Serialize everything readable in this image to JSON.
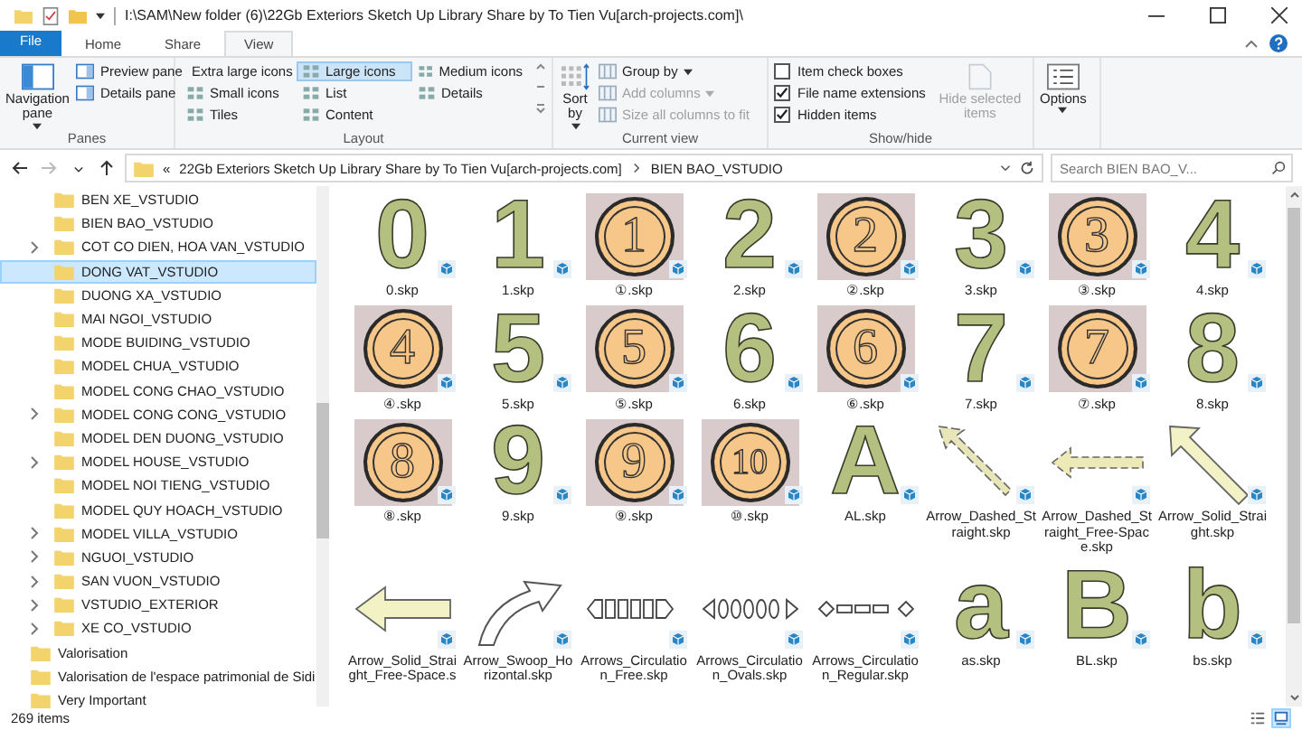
{
  "window": {
    "title": "I:\\SAM\\New folder (6)\\22Gb Exteriors Sketch Up Library Share by To Tien Vu[arch-projects.com]\\"
  },
  "ribbon_tabs": [
    {
      "label": "File",
      "kind": "file",
      "selected": false
    },
    {
      "label": "Home",
      "kind": "tab",
      "selected": false
    },
    {
      "label": "Share",
      "kind": "tab",
      "selected": false
    },
    {
      "label": "View",
      "kind": "tab",
      "selected": true
    }
  ],
  "ribbon": {
    "panes": {
      "title": "Panes",
      "navigation_pane": "Navigation pane",
      "preview_pane": "Preview pane",
      "details_pane": "Details pane"
    },
    "layout": {
      "title": "Layout",
      "options": [
        {
          "label": "Extra large icons",
          "selected": false
        },
        {
          "label": "Large icons",
          "selected": true
        },
        {
          "label": "Medium icons",
          "selected": false
        },
        {
          "label": "Small icons",
          "selected": false
        },
        {
          "label": "List",
          "selected": false
        },
        {
          "label": "Details",
          "selected": false
        },
        {
          "label": "Tiles",
          "selected": false
        },
        {
          "label": "Content",
          "selected": false
        }
      ]
    },
    "current_view": {
      "title": "Current view",
      "sort_by": "Sort by",
      "items": [
        {
          "label": "Group by",
          "disabled": false
        },
        {
          "label": "Add columns",
          "disabled": true
        },
        {
          "label": "Size all columns to fit",
          "disabled": true
        }
      ]
    },
    "show_hide": {
      "title": "Show/hide",
      "checkboxes": [
        {
          "label": "Item check boxes",
          "checked": false
        },
        {
          "label": "File name extensions",
          "checked": true
        },
        {
          "label": "Hidden items",
          "checked": true
        }
      ],
      "hide_selected": {
        "label": "Hide selected items",
        "disabled": true
      }
    },
    "options": "Options"
  },
  "address_bar": {
    "nav_buttons": [
      {
        "kind": "back",
        "disabled": false
      },
      {
        "kind": "forward",
        "disabled": true
      },
      {
        "kind": "recent",
        "disabled": false
      },
      {
        "kind": "up",
        "disabled": false
      }
    ],
    "overflow": "«",
    "path": [
      "22Gb Exteriors Sketch Up Library Share by To Tien Vu[arch-projects.com]",
      "BIEN BAO_VSTUDIO"
    ],
    "search": {
      "placeholder": "Search BIEN BAO_V..."
    }
  },
  "sidebar": {
    "subfolders": [
      {
        "label": "BEN XE_VSTUDIO",
        "expandable": false,
        "selected": false
      },
      {
        "label": "BIEN BAO_VSTUDIO",
        "expandable": false,
        "selected": false
      },
      {
        "label": "COT CO DIEN, HOA VAN_VSTUDIO",
        "expandable": true,
        "selected": false
      },
      {
        "label": "DONG VAT_VSTUDIO",
        "expandable": false,
        "selected": true
      },
      {
        "label": "DUONG XA_VSTUDIO",
        "expandable": false,
        "selected": false
      },
      {
        "label": "MAI NGOI_VSTUDIO",
        "expandable": false,
        "selected": false
      },
      {
        "label": "MODE BUIDING_VSTUDIO",
        "expandable": false,
        "selected": false
      },
      {
        "label": "MODEL CHUA_VSTUDIO",
        "expandable": false,
        "selected": false
      },
      {
        "label": "MODEL CONG CHAO_VSTUDIO",
        "expandable": false,
        "selected": false
      },
      {
        "label": "MODEL CONG CONG_VSTUDIO",
        "expandable": true,
        "selected": false
      },
      {
        "label": "MODEL DEN DUONG_VSTUDIO",
        "expandable": false,
        "selected": false
      },
      {
        "label": "MODEL HOUSE_VSTUDIO",
        "expandable": true,
        "selected": false
      },
      {
        "label": "MODEL NOI TIENG_VSTUDIO",
        "expandable": false,
        "selected": false
      },
      {
        "label": "MODEL QUY HOACH_VSTUDIO",
        "expandable": false,
        "selected": false
      },
      {
        "label": "MODEL VILLA_VSTUDIO",
        "expandable": true,
        "selected": false
      },
      {
        "label": "NGUOI_VSTUDIO",
        "expandable": true,
        "selected": false
      },
      {
        "label": "SAN VUON_VSTUDIO",
        "expandable": true,
        "selected": false
      },
      {
        "label": "VSTUDIO_EXTERIOR",
        "expandable": true,
        "selected": false
      },
      {
        "label": "XE CO_VSTUDIO",
        "expandable": true,
        "selected": false
      }
    ],
    "folders": [
      {
        "label": "Valorisation",
        "expandable": false,
        "selected": false
      },
      {
        "label": "Valorisation de  l'espace patrimonial de Sidi",
        "expandable": false,
        "selected": false
      },
      {
        "label": "Very Important",
        "expandable": false,
        "selected": false
      }
    ]
  },
  "files": [
    {
      "name": "0.skp",
      "kind": "digit",
      "glyph": "0"
    },
    {
      "name": "1.skp",
      "kind": "digit",
      "glyph": "1"
    },
    {
      "name": "①.skp",
      "kind": "circled",
      "glyph": "1"
    },
    {
      "name": "2.skp",
      "kind": "digit",
      "glyph": "2"
    },
    {
      "name": "②.skp",
      "kind": "circled",
      "glyph": "2"
    },
    {
      "name": "3.skp",
      "kind": "digit",
      "glyph": "3"
    },
    {
      "name": "③.skp",
      "kind": "circled",
      "glyph": "3"
    },
    {
      "name": "4.skp",
      "kind": "digit",
      "glyph": "4"
    },
    {
      "name": "④.skp",
      "kind": "circled",
      "glyph": "4"
    },
    {
      "name": "5.skp",
      "kind": "digit",
      "glyph": "5"
    },
    {
      "name": "⑤.skp",
      "kind": "circled",
      "glyph": "5"
    },
    {
      "name": "6.skp",
      "kind": "digit",
      "glyph": "6"
    },
    {
      "name": "⑥.skp",
      "kind": "circled",
      "glyph": "6"
    },
    {
      "name": "7.skp",
      "kind": "digit",
      "glyph": "7"
    },
    {
      "name": "⑦.skp",
      "kind": "circled",
      "glyph": "7"
    },
    {
      "name": "8.skp",
      "kind": "digit",
      "glyph": "8"
    },
    {
      "name": "⑧.skp",
      "kind": "circled",
      "glyph": "8"
    },
    {
      "name": "9.skp",
      "kind": "digit",
      "glyph": "9"
    },
    {
      "name": "⑨.skp",
      "kind": "circled",
      "glyph": "9"
    },
    {
      "name": "⑩.skp",
      "kind": "circled",
      "glyph": "10"
    },
    {
      "name": "AL.skp",
      "kind": "digit",
      "glyph": "A"
    },
    {
      "name": "Arrow_Dashed_Straight.skp",
      "kind": "arrow_dashed"
    },
    {
      "name": "Arrow_Dashed_Straight_Free-Space.skp",
      "kind": "arrow_dashed_free"
    },
    {
      "name": "Arrow_Solid_Straight.skp",
      "kind": "arrow_solid"
    },
    {
      "name": "Arrow_Solid_Straight_Free-Space.s",
      "kind": "arrow_solid_free"
    },
    {
      "name": "Arrow_Swoop_Horizontal.skp",
      "kind": "swoop"
    },
    {
      "name": "Arrows_Circulation_Free.skp",
      "kind": "circ_free"
    },
    {
      "name": "Arrows_Circulation_Ovals.skp",
      "kind": "circ_ovals"
    },
    {
      "name": "Arrows_Circulation_Regular.skp",
      "kind": "circ_regular"
    },
    {
      "name": "as.skp",
      "kind": "digit",
      "glyph": "a"
    },
    {
      "name": "BL.skp",
      "kind": "digit",
      "glyph": "B"
    },
    {
      "name": "bs.skp",
      "kind": "digit",
      "glyph": "b"
    }
  ],
  "status_bar": {
    "item_count": "269 items",
    "views": [
      {
        "kind": "details",
        "selected": false
      },
      {
        "kind": "large_icons",
        "selected": true
      }
    ]
  }
}
